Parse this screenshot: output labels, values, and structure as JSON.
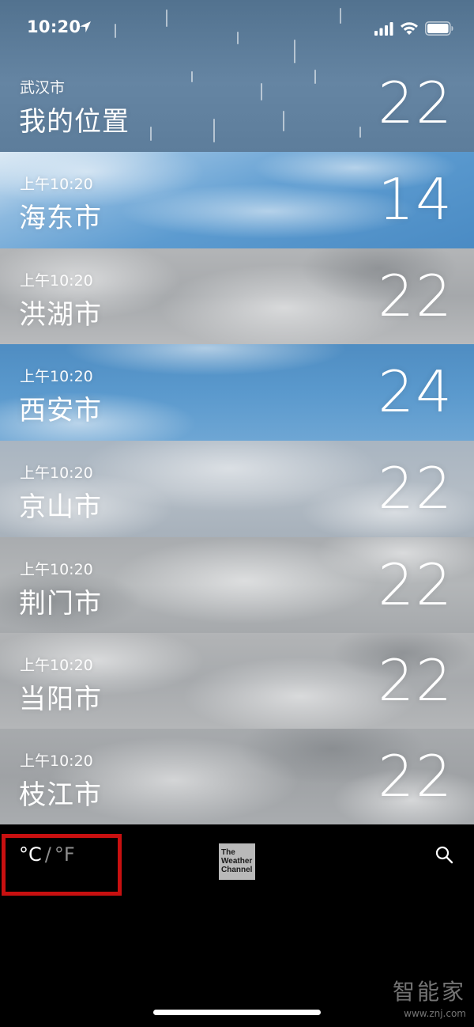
{
  "status_bar": {
    "time": "10:20"
  },
  "cities": [
    {
      "subtitle": "武汉市",
      "name": "我的位置",
      "temp": "22",
      "theme": "rain"
    },
    {
      "subtitle": "上午10:20",
      "name": "海东市",
      "temp": "14",
      "theme": "clear"
    },
    {
      "subtitle": "上午10:20",
      "name": "洪湖市",
      "temp": "22",
      "theme": "cloudy"
    },
    {
      "subtitle": "上午10:20",
      "name": "西安市",
      "temp": "24",
      "theme": "clear"
    },
    {
      "subtitle": "上午10:20",
      "name": "京山市",
      "temp": "22",
      "theme": "partly"
    },
    {
      "subtitle": "上午10:20",
      "name": "荆门市",
      "temp": "22",
      "theme": "cloudy"
    },
    {
      "subtitle": "上午10:20",
      "name": "当阳市",
      "temp": "22",
      "theme": "cloudy"
    },
    {
      "subtitle": "上午10:20",
      "name": "枝江市",
      "temp": "22",
      "theme": "cloudy"
    }
  ],
  "toolbar": {
    "celsius": "°C",
    "separator": "/",
    "fahrenheit": "°F",
    "logo_line1": "The",
    "logo_line2": "Weather",
    "logo_line3": "Channel",
    "search_icon": "search-icon"
  },
  "watermark": {
    "cn": "智能家",
    "en": "www.znj.com"
  },
  "colors": {
    "highlight": "#c81010",
    "rain_bg": "#5f7d9a",
    "clear_bg": "#4f8fc4",
    "cloudy_bg": "#a8abae"
  }
}
